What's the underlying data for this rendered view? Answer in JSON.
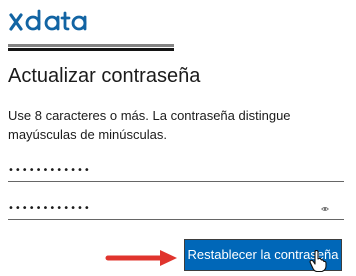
{
  "logo": {
    "text": "xdata",
    "color": "#1264a3"
  },
  "heading": {
    "title": "Actualizar contraseña",
    "description": "Use 8 caracteres o más. La contraseña distingue mayúsculas de minúsculas."
  },
  "form": {
    "new_password_value": "••••••••••••",
    "confirm_password_value": "••••••••••••",
    "reveal_icon": "eye-icon"
  },
  "actions": {
    "submit_label": "Restablecer la contraseña",
    "submit_color": "#0067b8"
  },
  "annotation": {
    "arrow_color": "#e0342d",
    "icon": "arrow-right-icon"
  },
  "cursor": {
    "icon": "hand-pointer-icon"
  }
}
